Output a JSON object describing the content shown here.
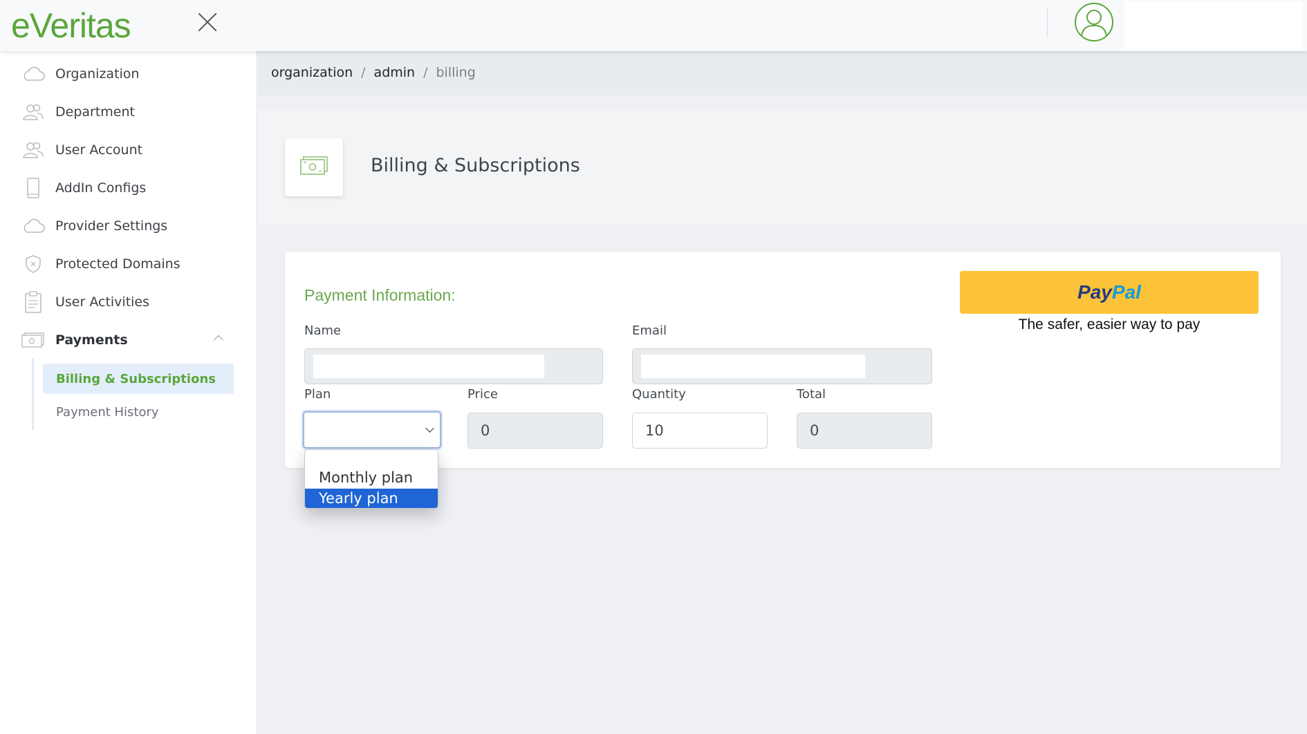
{
  "header": {
    "logo_text": "eVeritas",
    "brand_color": "#5aa63c"
  },
  "sidebar": {
    "items": [
      {
        "label": "Organization",
        "icon": "cloud-icon"
      },
      {
        "label": "Department",
        "icon": "users-icon"
      },
      {
        "label": "User Account",
        "icon": "users-icon"
      },
      {
        "label": "AddIn Configs",
        "icon": "phone-icon"
      },
      {
        "label": "Provider Settings",
        "icon": "cloud-icon"
      },
      {
        "label": "Protected Domains",
        "icon": "shield-icon"
      },
      {
        "label": "User Activities",
        "icon": "clipboard-icon"
      },
      {
        "label": "Payments",
        "icon": "money-icon"
      }
    ],
    "sub_items": [
      {
        "label": "Billing & Subscriptions",
        "active": true
      },
      {
        "label": "Payment History",
        "active": false
      }
    ]
  },
  "breadcrumb": {
    "items": [
      "organization",
      "admin"
    ],
    "separator": "/",
    "current": "billing"
  },
  "page": {
    "title": "Billing & Subscriptions",
    "icon": "money-icon"
  },
  "form": {
    "section_title": "Payment Information:",
    "name_label": "Name",
    "email_label": "Email",
    "plan_label": "Plan",
    "price_label": "Price",
    "price_value": "0",
    "quantity_label": "Quantity",
    "quantity_value": "10",
    "total_label": "Total",
    "total_value": "0",
    "plan_options": [
      "Monthly plan",
      "Yearly plan"
    ],
    "highlighted_option": "Yearly plan"
  },
  "paypal": {
    "logo_pay": "Pay",
    "logo_pal": "Pal",
    "tagline": "The safer, easier way to pay",
    "button_color": "#fcc33a"
  }
}
